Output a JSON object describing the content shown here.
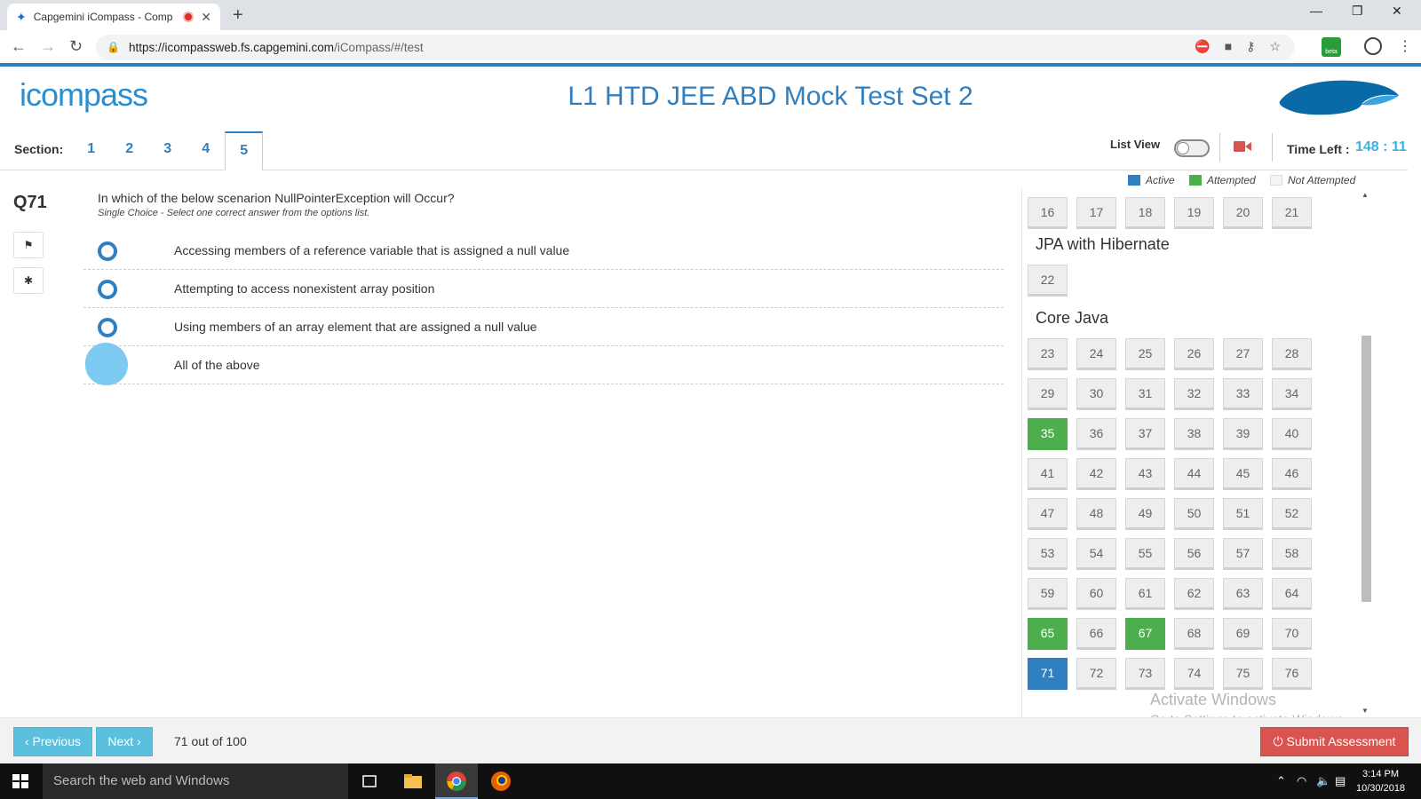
{
  "browser": {
    "tab_title": "Capgemini iCompass - Comp",
    "url_host": "https://icompassweb.fs.capgemini.com",
    "url_path": "/iCompass/#/test",
    "ext_badge": "beta"
  },
  "header": {
    "logo_text": "icompass",
    "test_title": "L1 HTD JEE ABD Mock Test Set 2"
  },
  "sections": {
    "label": "Section:",
    "tabs": [
      "1",
      "2",
      "3",
      "4",
      "5"
    ],
    "active_index": 4
  },
  "controls": {
    "list_view_label": "List View",
    "list_view_on": false,
    "time_left_label": "Time Left :",
    "time_left_value": "148 : 11"
  },
  "question": {
    "number": "Q71",
    "text": "In which of the below scenarion NullPointerException will Occur?",
    "hint": "Single Choice - Select one correct answer from the options list.",
    "options": [
      "Accessing members of a reference variable that is assigned a null value",
      "Attempting to access nonexistent array position",
      "Using members of an array element that are assigned a null value",
      "All of the above"
    ]
  },
  "legend": {
    "active": "Active",
    "attempted": "Attempted",
    "not_attempted": "Not Attempted"
  },
  "colors": {
    "active": "#2f7fc1",
    "attempted": "#4cae4c",
    "not_attempted": "#eeeeee",
    "submit": "#d9534f",
    "nav": "#5bc0de"
  },
  "question_panel": {
    "groups": [
      {
        "title": "",
        "numbers": [
          "16",
          "17",
          "18",
          "19",
          "20",
          "21"
        ]
      },
      {
        "title": "JPA with Hibernate",
        "numbers": [
          "22"
        ]
      },
      {
        "title": "Core Java",
        "numbers": [
          "23",
          "24",
          "25",
          "26",
          "27",
          "28",
          "29",
          "30",
          "31",
          "32",
          "33",
          "34",
          "35",
          "36",
          "37",
          "38",
          "39",
          "40",
          "41",
          "42",
          "43",
          "44",
          "45",
          "46",
          "47",
          "48",
          "49",
          "50",
          "51",
          "52",
          "53",
          "54",
          "55",
          "56",
          "57",
          "58",
          "59",
          "60",
          "61",
          "62",
          "63",
          "64",
          "65",
          "66",
          "67",
          "68",
          "69",
          "70",
          "71",
          "72",
          "73",
          "74",
          "75",
          "76"
        ]
      }
    ],
    "attempted": [
      "35",
      "65",
      "67"
    ],
    "active": "71"
  },
  "footer": {
    "previous_label": "‹ Previous",
    "next_label": "Next ›",
    "progress": "71 out of 100",
    "submit_label": "⏻ Submit Assessment"
  },
  "watermark": {
    "line1": "Activate Windows",
    "line2": "Go to Settings to activate Windows."
  },
  "taskbar": {
    "search_placeholder": "Search the web and Windows",
    "time": "3:14 PM",
    "date": "10/30/2018"
  }
}
